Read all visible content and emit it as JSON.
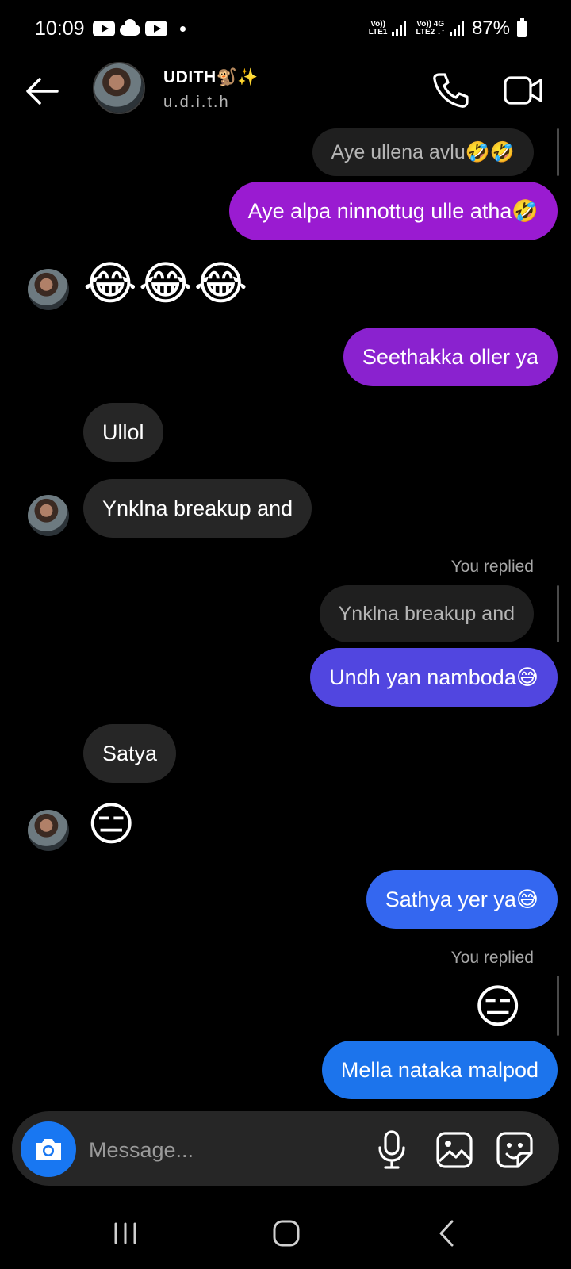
{
  "status_bar": {
    "time": "10:09",
    "net1_top": "Vo))",
    "net1_bottom": "LTE1",
    "net2_top": "Vo)) 4G",
    "net2_bottom": "LTE2 ↓↑",
    "battery": "87%"
  },
  "header": {
    "name": "UDITH🐒✨",
    "handle": "u.d.i.t.h"
  },
  "messages": {
    "m1_quote": "Aye ullena avlu🤣🤣",
    "m2_out": "Aye alpa ninnottug ulle atha🤣",
    "m3_emojis": "😂😂😂",
    "m4_out": "Seethakka oller ya",
    "m5_in": "Ullol",
    "m6_in": "Ynklna breakup and",
    "m7_replied_label": "You replied",
    "m7_quote": "Ynklna breakup and",
    "m8_out": "Undh yan namboda😅",
    "m9_in": "Satya",
    "m10_emoji": "😑",
    "m11_out": "Sathya yer ya😅",
    "m12_replied_label": "You replied",
    "m12_quote_emoji": "😑",
    "m13_out": "Mella nataka malpod"
  },
  "composer": {
    "placeholder": "Message..."
  },
  "colors": {
    "purple": "#9a1bd1",
    "violet": "#8a22cf",
    "indigo": "#5146e0",
    "blue": "#3467f0",
    "blue2": "#1c74ec",
    "camera": "#1877f2"
  }
}
